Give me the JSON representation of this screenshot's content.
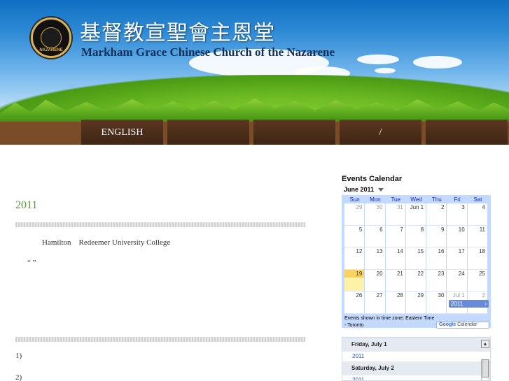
{
  "header": {
    "title_cn": "基督教宣聖會主恩堂",
    "title_en": "Markham Grace Chinese Church of the Nazarene",
    "logo_text": "NAZARENE"
  },
  "nav": {
    "items": [
      {
        "label": "ENGLISH"
      },
      {
        "label": ""
      },
      {
        "label": ""
      },
      {
        "label": "/"
      },
      {
        "label": ""
      }
    ]
  },
  "main": {
    "year": "2011",
    "para1": "Hamilton    Redeemer University College",
    "para2": "“ ”",
    "item1": "1)",
    "item2": "2)"
  },
  "calendar": {
    "title": "Events Calendar",
    "month": "June 2011",
    "weekdays": [
      "Sun",
      "Mon",
      "Tue",
      "Wed",
      "Thu",
      "Fri",
      "Sat"
    ],
    "weeks": [
      [
        "29",
        "30",
        "31",
        "Jun 1",
        "2",
        "3",
        "4"
      ],
      [
        "5",
        "6",
        "7",
        "8",
        "9",
        "10",
        "11"
      ],
      [
        "12",
        "13",
        "14",
        "15",
        "16",
        "17",
        "18"
      ],
      [
        "19",
        "20",
        "21",
        "22",
        "23",
        "24",
        "25"
      ],
      [
        "26",
        "27",
        "28",
        "29",
        "30",
        "Jul 1",
        "2"
      ]
    ],
    "event_label": "2011",
    "timezone_note": "Events shown in time zone: Eastern Time - Toronto",
    "gcal_label": "Calendar",
    "gcal_brand": "Google"
  },
  "agenda": {
    "days": [
      {
        "label": "Friday, July 1",
        "events": [
          "2011"
        ]
      },
      {
        "label": "Saturday, July 2",
        "events": [
          "2011"
        ]
      }
    ]
  },
  "colors": {
    "nav_bg": "#4a2c19",
    "year_green": "#5c9b3c",
    "calendar_frame": "#c3d9ff",
    "calendar_event": "#668cd9",
    "today_highlight": "#fad163"
  }
}
